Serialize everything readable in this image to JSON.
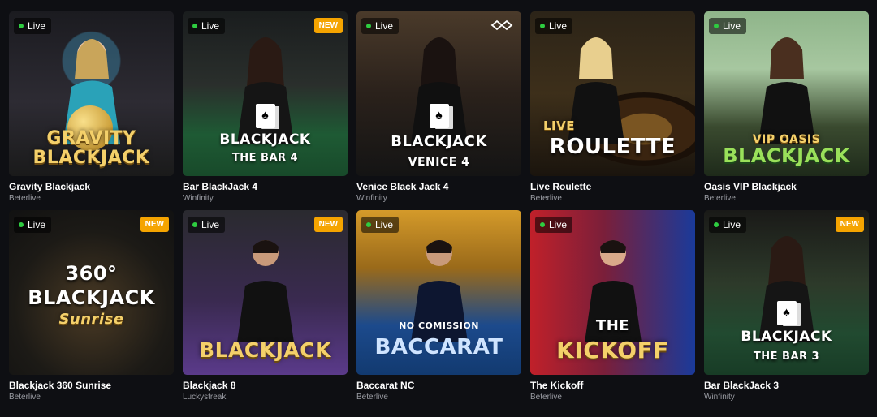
{
  "games": [
    {
      "name": "Gravity Blackjack",
      "provider": "Beterlive",
      "live": "Live",
      "badge": "",
      "title_top": "GRAVITY",
      "title_bottom": "BLACKJACK",
      "bg": "#2a2a2e",
      "accent": "#f4d06a"
    },
    {
      "name": "Bar BlackJack 4",
      "provider": "Winfinity",
      "live": "Live",
      "badge": "NEW",
      "title_top": "BLACKJACK",
      "title_bottom": "THE BAR 4",
      "bg": "#1d4a2c",
      "accent": "#ffffff"
    },
    {
      "name": "Venice Black Jack 4",
      "provider": "Winfinity",
      "live": "Live",
      "badge": "",
      "title_top": "BLACKJACK",
      "title_bottom": "VENICE 4",
      "bg": "#2a1f18",
      "accent": "#ffffff"
    },
    {
      "name": "Live Roulette",
      "provider": "Beterlive",
      "live": "Live",
      "badge": "",
      "title_top": "LIVE",
      "title_bottom": "ROULETTE",
      "bg": "#3a2a14",
      "accent": "#f4d06a"
    },
    {
      "name": "Oasis VIP Blackjack",
      "provider": "Beterlive",
      "live": "Live",
      "badge": "",
      "title_top": "VIP  Oasis",
      "title_bottom": "BLACKJACK",
      "bg": "#3b5a3a",
      "accent": "#f4d06a"
    },
    {
      "name": "Blackjack 360 Sunrise",
      "provider": "Beterlive",
      "live": "Live",
      "badge": "NEW",
      "title_top": "360°",
      "title_bottom": "BLACKJACK",
      "title_sub": "Sunrise",
      "bg": "#1c1a16",
      "accent": "#f4d06a"
    },
    {
      "name": "Blackjack 8",
      "provider": "Luckystreak",
      "live": "Live",
      "badge": "NEW",
      "title_top": "",
      "title_bottom": "BLACKJACK",
      "bg": "#3b2a55",
      "accent": "#f4d06a"
    },
    {
      "name": "Baccarat NC",
      "provider": "Beterlive",
      "live": "Live",
      "badge": "",
      "title_top": "NO COMISSION",
      "title_bottom": "BACCARAT",
      "bg": "#1c4a8c",
      "accent": "#cfe4ff"
    },
    {
      "name": "The Kickoff",
      "provider": "Beterlive",
      "live": "Live",
      "badge": "",
      "title_top": "THE",
      "title_bottom": "KICKOFF",
      "bg": "#7a1f2a",
      "accent": "#f4d06a"
    },
    {
      "name": "Bar BlackJack 3",
      "provider": "Winfinity",
      "live": "Live",
      "badge": "NEW",
      "title_top": "BLACKJACK",
      "title_bottom": "THE BAR 3",
      "bg": "#214a30",
      "accent": "#ffffff"
    }
  ]
}
